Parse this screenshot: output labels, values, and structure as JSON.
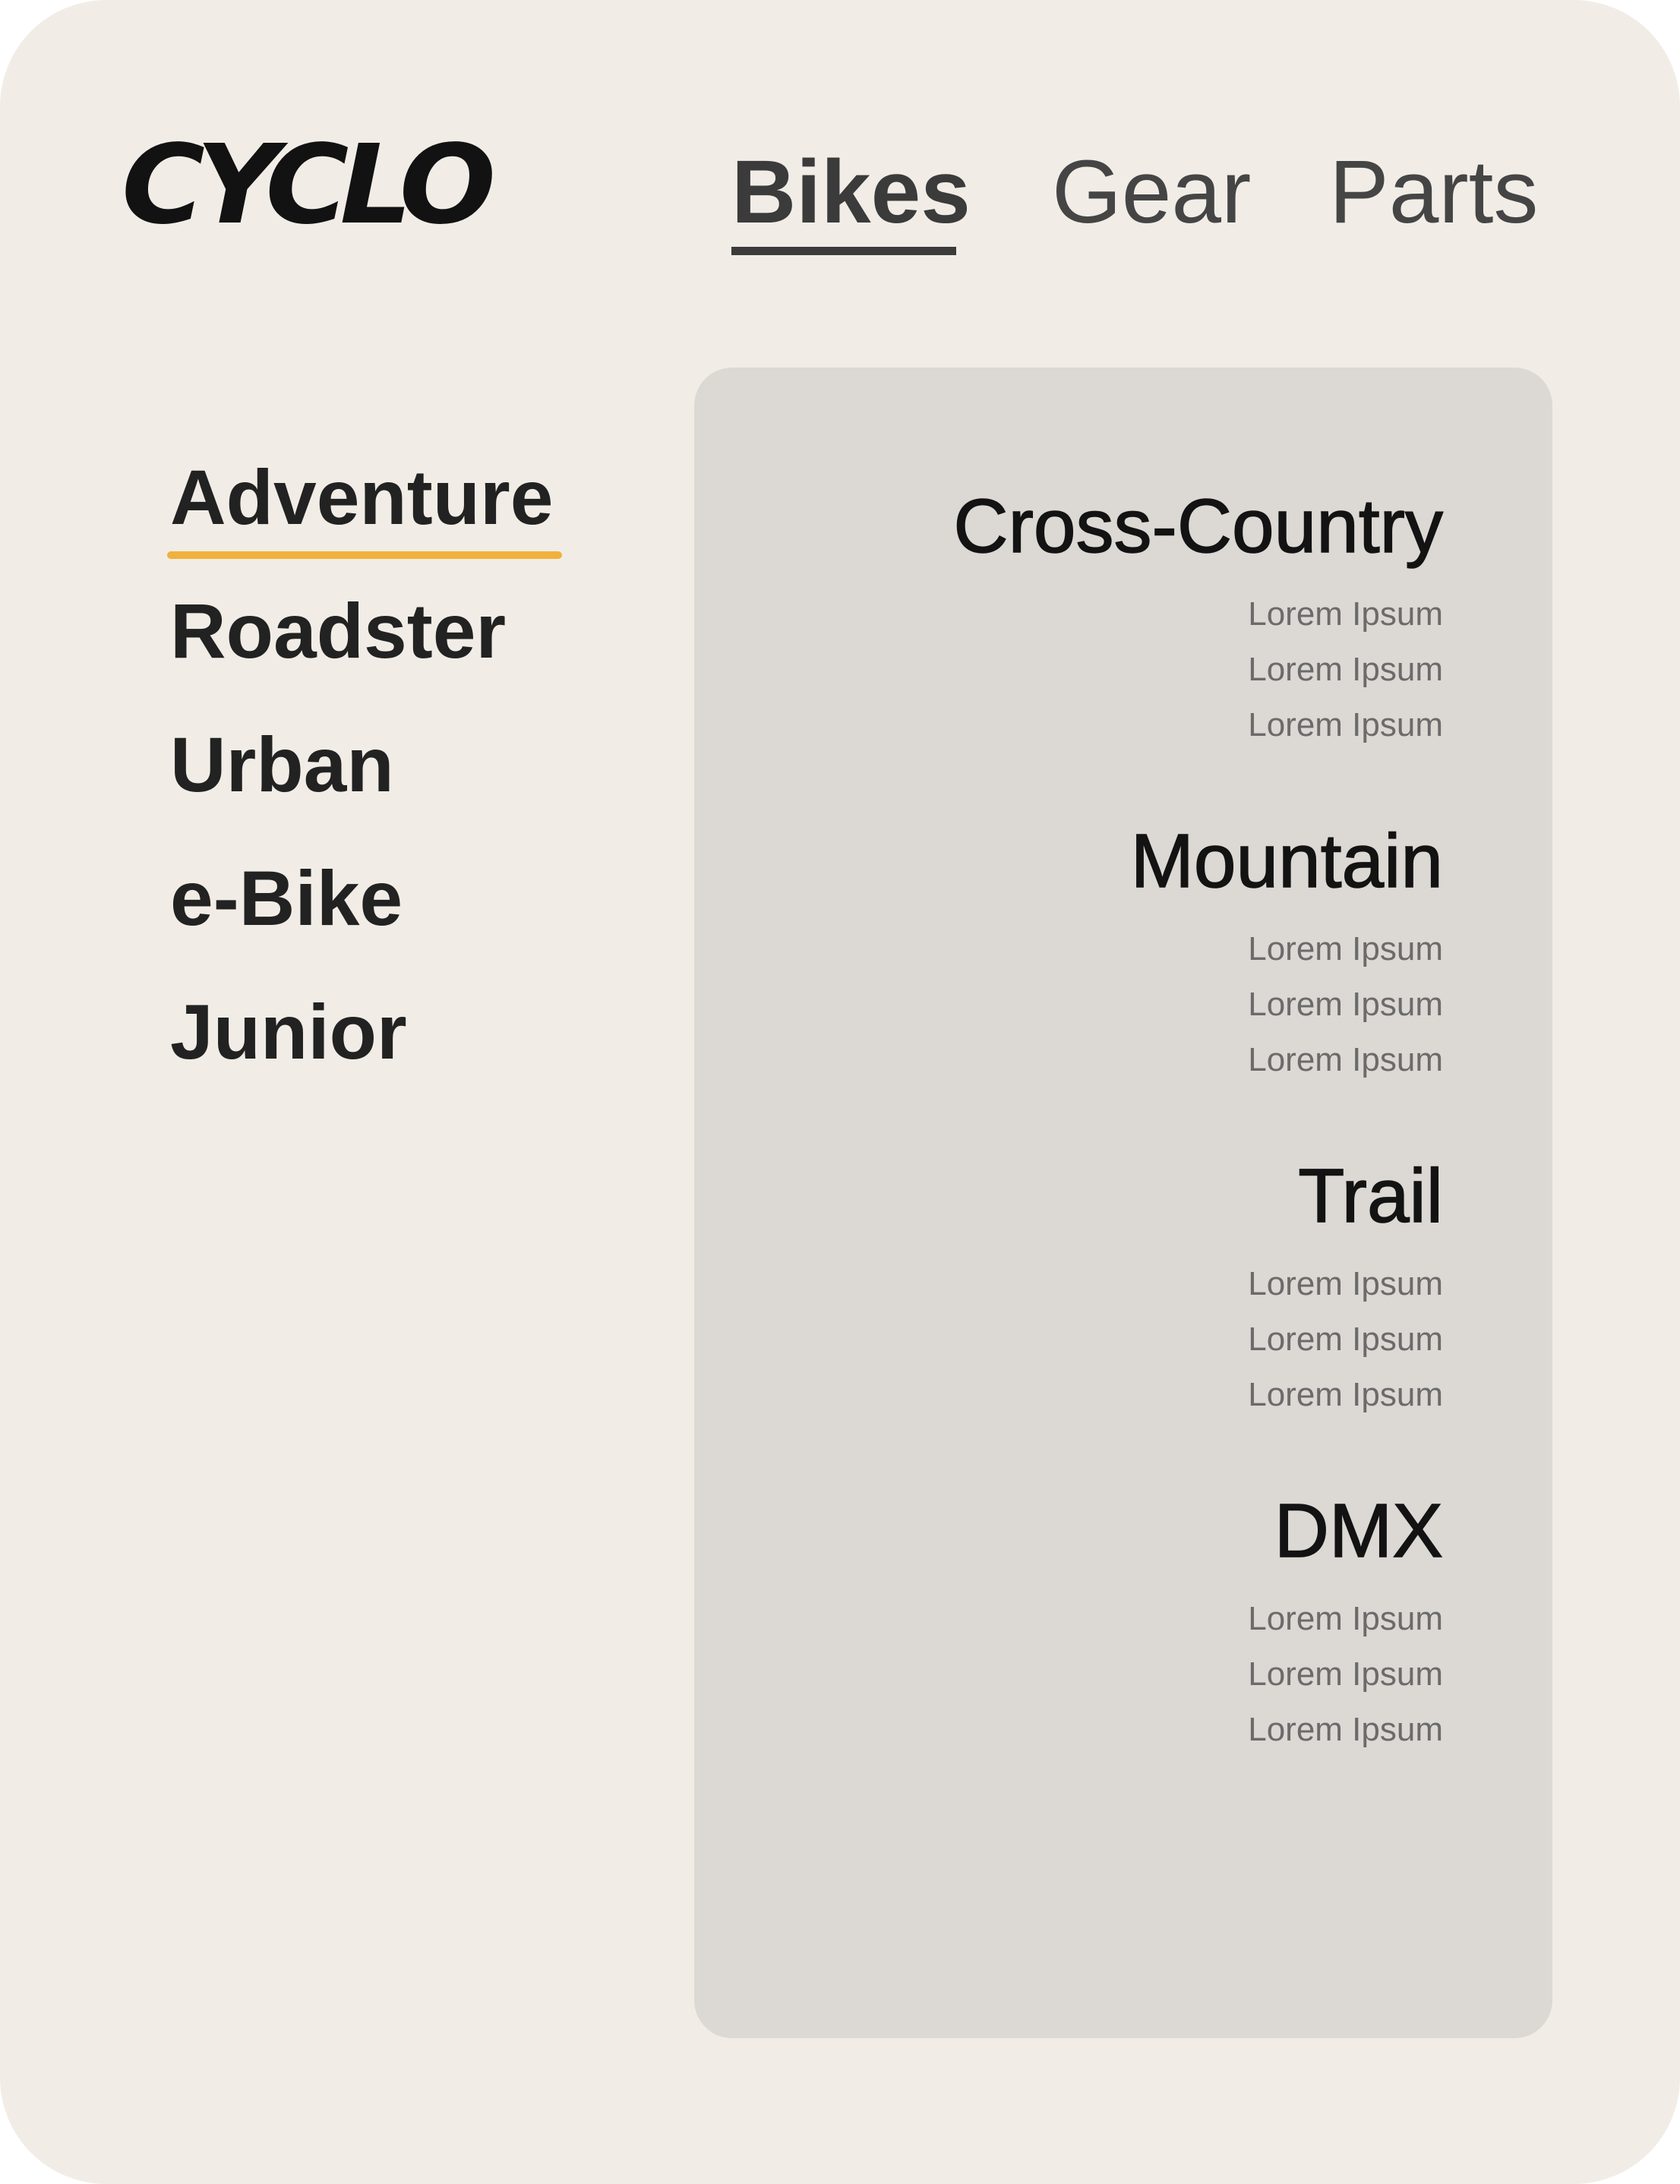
{
  "app": {
    "logo_text": "CYCLO"
  },
  "top_nav": {
    "tabs": [
      {
        "label": "Bikes",
        "active": true
      },
      {
        "label": "Gear",
        "active": false
      },
      {
        "label": "Parts",
        "active": false
      }
    ]
  },
  "sidebar": {
    "items": [
      {
        "label": "Adventure",
        "active": true
      },
      {
        "label": "Roadster",
        "active": false
      },
      {
        "label": "Urban",
        "active": false
      },
      {
        "label": "e-Bike",
        "active": false
      },
      {
        "label": "Junior",
        "active": false
      }
    ]
  },
  "panel": {
    "groups": [
      {
        "title": "Cross-Country",
        "links": [
          "Lorem Ipsum",
          "Lorem Ipsum",
          "Lorem Ipsum"
        ]
      },
      {
        "title": "Mountain",
        "links": [
          "Lorem Ipsum",
          "Lorem Ipsum",
          "Lorem Ipsum"
        ]
      },
      {
        "title": "Trail",
        "links": [
          "Lorem Ipsum",
          "Lorem Ipsum",
          "Lorem Ipsum"
        ]
      },
      {
        "title": "DMX",
        "links": [
          "Lorem Ipsum",
          "Lorem Ipsum",
          "Lorem Ipsum"
        ]
      }
    ]
  },
  "colors": {
    "background": "#f1ede6",
    "panel": "#dcd8d3",
    "accent_underline": "#f0b23c",
    "text_dark": "#222222",
    "text_muted": "#6b6b6b"
  }
}
